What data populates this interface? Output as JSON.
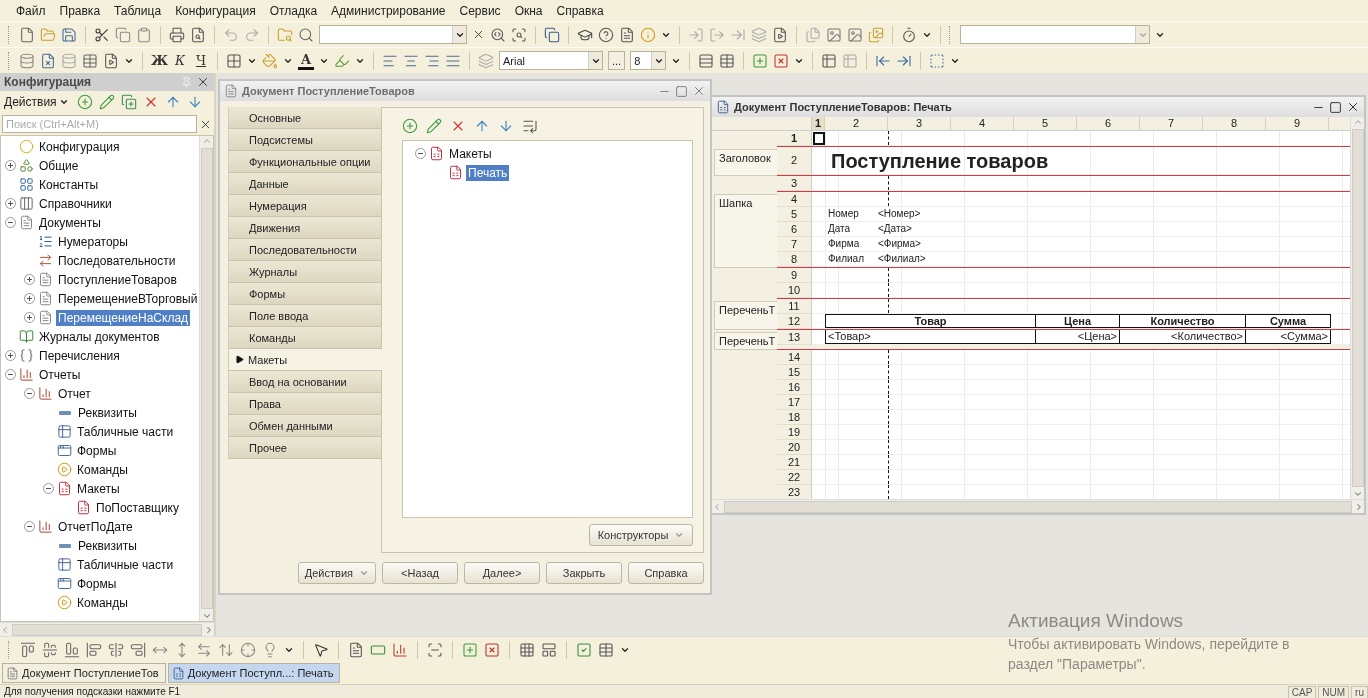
{
  "menu": [
    "Файл",
    "Правка",
    "Таблица",
    "Конфигурация",
    "Отладка",
    "Администрирование",
    "Сервис",
    "Окна",
    "Справка"
  ],
  "format_toolbar": {
    "style_buttons": [
      {
        "label": "Ж",
        "kind": "bold"
      },
      {
        "label": "К",
        "kind": "italic"
      },
      {
        "label": "Ч",
        "kind": "underline"
      }
    ],
    "font_color_button": "A",
    "font": "Arial",
    "font_more_button": "...",
    "font_size": "8"
  },
  "config_panel": {
    "title": "Конфигурация",
    "actions_button": "Действия",
    "search": {
      "placeholder": "Поиск (Ctrl+Alt+M)"
    },
    "tree": [
      {
        "label": "Конфигурация",
        "kind": "config",
        "selected": false
      },
      {
        "label": "Общие",
        "kind": "common",
        "expanded": false,
        "selected": false
      },
      {
        "label": "Константы",
        "kind": "constants",
        "selected": false
      },
      {
        "label": "Справочники",
        "kind": "catalogs",
        "expanded": false,
        "selected": false
      },
      {
        "label": "Документы",
        "kind": "documents",
        "expanded": true,
        "selected": false,
        "children": [
          {
            "label": "Нумераторы",
            "kind": "numerators",
            "selected": false
          },
          {
            "label": "Последовательности",
            "kind": "sequences",
            "selected": false
          },
          {
            "label": "ПоступлениеТоваров",
            "kind": "document",
            "expanded": false,
            "selected": false
          },
          {
            "label": "ПеремещениеВТорговый",
            "kind": "document",
            "expanded": false,
            "selected": false
          },
          {
            "label": "ПеремещениеНаСклад",
            "kind": "document",
            "expanded": false,
            "selected": true
          }
        ]
      },
      {
        "label": "Журналы документов",
        "kind": "journals",
        "selected": false
      },
      {
        "label": "Перечисления",
        "kind": "enums",
        "expanded": false,
        "selected": false
      },
      {
        "label": "Отчеты",
        "kind": "reports",
        "expanded": true,
        "selected": false,
        "children": [
          {
            "label": "Отчет",
            "kind": "reports",
            "expanded": true,
            "selected": false,
            "children": [
              {
                "label": "Реквизиты",
                "kind": "attributes",
                "selected": false
              },
              {
                "label": "Табличные части",
                "kind": "tables",
                "selected": false
              },
              {
                "label": "Формы",
                "kind": "forms",
                "selected": false
              },
              {
                "label": "Команды",
                "kind": "commands",
                "selected": false
              },
              {
                "label": "Макеты",
                "kind": "templates",
                "expanded": true,
                "selected": false,
                "children": [
                  {
                    "label": "ПоПоставщику",
                    "kind": "templates",
                    "selected": false
                  }
                ]
              }
            ]
          },
          {
            "label": "ОтчетПоДате",
            "kind": "reports",
            "expanded": true,
            "selected": false,
            "children": [
              {
                "label": "Реквизиты",
                "kind": "attributes",
                "selected": false
              },
              {
                "label": "Табличные части",
                "kind": "tables",
                "selected": false
              },
              {
                "label": "Формы",
                "kind": "forms",
                "selected": false
              },
              {
                "label": "Команды",
                "kind": "commands",
                "selected": false
              }
            ]
          }
        ]
      }
    ]
  },
  "doc_window": {
    "title": "Документ ПоступлениеТоваров",
    "tabs": [
      {
        "label": "Основные",
        "selected": false
      },
      {
        "label": "Подсистемы",
        "selected": false
      },
      {
        "label": "Функциональные опции",
        "selected": false
      },
      {
        "label": "Данные",
        "selected": false
      },
      {
        "label": "Нумерация",
        "selected": false
      },
      {
        "label": "Движения",
        "selected": false
      },
      {
        "label": "Последовательности",
        "selected": false
      },
      {
        "label": "Журналы",
        "selected": false
      },
      {
        "label": "Формы",
        "selected": false
      },
      {
        "label": "Поле ввода",
        "selected": false
      },
      {
        "label": "Команды",
        "selected": false
      },
      {
        "label": "Макеты",
        "selected": true
      },
      {
        "label": "Ввод на основании",
        "selected": false
      },
      {
        "label": "Права",
        "selected": false
      },
      {
        "label": "Обмен данными",
        "selected": false
      },
      {
        "label": "Прочее",
        "selected": false
      }
    ],
    "tree": [
      {
        "label": "Макеты",
        "expanded": true,
        "selected": false,
        "children": [
          {
            "label": "Печать",
            "selected": true
          }
        ]
      }
    ],
    "constructors_button": "Конструкторы",
    "buttons": [
      {
        "label": "Действия",
        "kind": "menu"
      },
      {
        "label": "<Назад",
        "kind": "plain"
      },
      {
        "label": "Далее>",
        "kind": "plain"
      },
      {
        "label": "Закрыть",
        "kind": "plain"
      },
      {
        "label": "Справка",
        "kind": "plain"
      }
    ]
  },
  "print_window": {
    "title": "Документ ПоступлениеТоваров: Печать",
    "columns": [
      {
        "label": "1",
        "selected": true
      },
      {
        "label": "2",
        "selected": false
      },
      {
        "label": "3",
        "selected": false
      },
      {
        "label": "4",
        "selected": false
      },
      {
        "label": "5",
        "selected": false
      },
      {
        "label": "6",
        "selected": false
      },
      {
        "label": "7",
        "selected": false
      },
      {
        "label": "8",
        "selected": false
      },
      {
        "label": "9",
        "selected": false
      }
    ],
    "sections": [
      {
        "rows": [
          {
            "number": "1",
            "kind": "empty",
            "selected": true
          }
        ]
      },
      {
        "label": "Заголовок",
        "rows": [
          {
            "number": "2",
            "kind": "title",
            "selected": false,
            "text": "Поступление товаров"
          }
        ]
      },
      {
        "rows": [
          {
            "number": "3",
            "kind": "empty",
            "selected": false
          }
        ]
      },
      {
        "label": "Шапка",
        "rows": [
          {
            "number": "4",
            "kind": "empty",
            "selected": false
          },
          {
            "number": "5",
            "kind": "field",
            "selected": false,
            "label": "Номер",
            "value": "<Номер>"
          },
          {
            "number": "6",
            "kind": "field",
            "selected": false,
            "label": "Дата",
            "value": "<Дата>"
          },
          {
            "number": "7",
            "kind": "field",
            "selected": false,
            "label": "Фирма",
            "value": "<Фирма>"
          },
          {
            "number": "8",
            "kind": "field",
            "selected": false,
            "label": "Филиал",
            "value": "<Филиал>"
          }
        ]
      },
      {
        "rows": [
          {
            "number": "9",
            "kind": "empty",
            "selected": false
          },
          {
            "number": "10",
            "kind": "empty",
            "selected": false
          }
        ]
      },
      {
        "label": "ПереченьТ",
        "rows": [
          {
            "number": "11",
            "kind": "empty",
            "selected": false
          },
          {
            "number": "12",
            "kind": "table_header",
            "selected": false,
            "cells": [
              "Товар",
              "Цена",
              "Количество",
              "Сумма"
            ]
          }
        ]
      },
      {
        "label": "ПереченьТ",
        "rows": [
          {
            "number": "13",
            "kind": "table_row",
            "selected": false,
            "cells": [
              "<Товар>",
              "<Цена>",
              "<Количество>",
              "<Сумма>"
            ]
          }
        ]
      },
      {
        "rows": [
          {
            "number": "14",
            "kind": "empty",
            "selected": false
          },
          {
            "number": "15",
            "kind": "empty",
            "selected": false
          },
          {
            "number": "16",
            "kind": "empty",
            "selected": false
          },
          {
            "number": "17",
            "kind": "empty",
            "selected": false
          },
          {
            "number": "18",
            "kind": "empty",
            "selected": false
          },
          {
            "number": "19",
            "kind": "empty",
            "selected": false
          },
          {
            "number": "20",
            "kind": "empty",
            "selected": false
          },
          {
            "number": "21",
            "kind": "empty",
            "selected": false
          },
          {
            "number": "22",
            "kind": "empty",
            "selected": false
          },
          {
            "number": "23",
            "kind": "empty",
            "selected": false
          }
        ]
      }
    ]
  },
  "activation_notice": {
    "title": "Активация Windows",
    "text": "Чтобы активировать Windows, перейдите в раздел \"Параметры\"."
  },
  "window_tabs": [
    {
      "label": "Документ ПоступлениеТов",
      "kind": "document",
      "selected": false
    },
    {
      "label": "Документ Поступл...: Печать",
      "kind": "print",
      "selected": true
    }
  ],
  "status_bar": {
    "hint": "Для получения подсказки нажмите F1",
    "indicators": [
      "CAP",
      "NUM",
      "ru"
    ]
  }
}
